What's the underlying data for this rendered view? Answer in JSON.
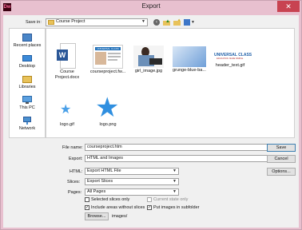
{
  "window": {
    "title": "Export",
    "close_glyph": "✕",
    "app_icon_text": "Dw"
  },
  "save_in": {
    "label": "Save in:",
    "value": "Course Project"
  },
  "places": [
    {
      "label": "Recent places",
      "icon": "recent-places-icon"
    },
    {
      "label": "Desktop",
      "icon": "desktop-icon"
    },
    {
      "label": "Libraries",
      "icon": "libraries-icon"
    },
    {
      "label": "This PC",
      "icon": "this-pc-icon"
    },
    {
      "label": "Network",
      "icon": "network-icon"
    }
  ],
  "files": [
    {
      "name": "Course Project.docx",
      "line1": "Course",
      "line2": "Project.docx"
    },
    {
      "name": "courseproject.fw...",
      "thumb_title": "UNIVERSAL CLASS"
    },
    {
      "name": "girl_image.jpg"
    },
    {
      "name": "grunge-blue-ba..."
    },
    {
      "name": "header_text.gif",
      "thumb_text": "UNIVERSAL CLASS",
      "thumb_sub": "EDUCATION. MADE SIMPLE."
    },
    {
      "name": "logo.gif"
    },
    {
      "name": "logo.png"
    }
  ],
  "form": {
    "file_name_label": "File name:",
    "file_name_value": "courseproject.htm",
    "export_label": "Export:",
    "export_value": "HTML and Images",
    "html_label": "HTML:",
    "html_value": "Export HTML File",
    "slices_label": "Slices:",
    "slices_value": "Export Slices",
    "pages_label": "Pages:",
    "pages_value": "All Pages",
    "selected_slices_label": "Selected slices only",
    "selected_slices_checked": false,
    "current_state_label": "Current state only",
    "current_state_checked": false,
    "include_areas_label": "Include areas without slices",
    "include_areas_checked": true,
    "put_images_label": "Put images in subfolder",
    "put_images_checked": true,
    "browse_label": "Browse...",
    "subfolder_value": "images/"
  },
  "buttons": {
    "save": "Save",
    "cancel": "Cancel",
    "options": "Options..."
  },
  "check_glyph": "✓"
}
